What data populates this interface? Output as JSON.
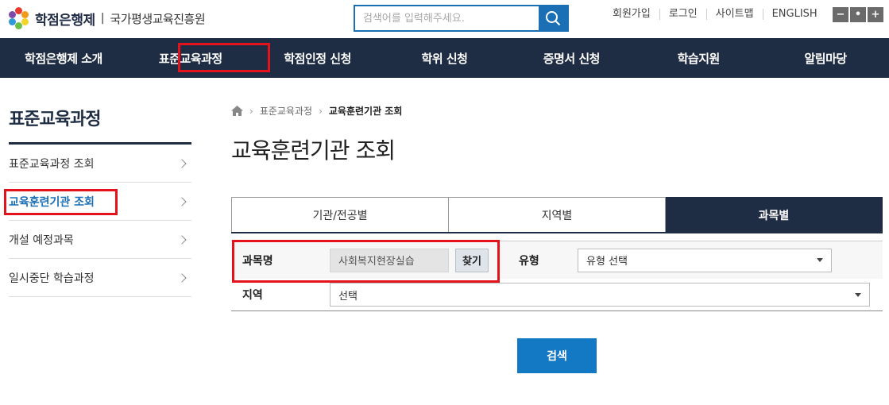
{
  "header": {
    "logo_title": "학점은행제",
    "logo_sub": "국가평생교육진흥원",
    "search_placeholder": "검색어를 입력해주세요.",
    "util_links": [
      "회원가입",
      "로그인",
      "사이트맵",
      "ENGLISH"
    ],
    "zoom": [
      "−",
      "•",
      "+"
    ],
    "logo_colors": [
      "#e8392f",
      "#f29a1b",
      "#f5d42a",
      "#6bbf47",
      "#2f9ad6",
      "#7d4aa8"
    ]
  },
  "gnb": {
    "items": [
      "학점은행제 소개",
      "표준교육과정",
      "학점인정 신청",
      "학위 신청",
      "증명서 신청",
      "학습지원",
      "알림마당"
    ],
    "active_index": 1
  },
  "sidebar": {
    "title": "표준교육과정",
    "items": [
      "표준교육과정 조회",
      "교육훈련기관 조회",
      "개설 예정과목",
      "일시중단 학습과정"
    ],
    "active_index": 1
  },
  "breadcrumb": {
    "parent": "표준교육과정",
    "current": "교육훈련기관 조회"
  },
  "page": {
    "title": "교육훈련기관 조회"
  },
  "tabs": {
    "items": [
      "기관/전공별",
      "지역별",
      "과목별"
    ],
    "active_index": 2
  },
  "form": {
    "subject_label": "과목명",
    "subject_value": "사회복지현장실습",
    "find_label": "찾기",
    "type_label": "유형",
    "type_value": "유형 선택",
    "region_label": "지역",
    "region_value": "선택"
  },
  "submit_label": "검색",
  "colors": {
    "navy": "#1f2d44",
    "accent": "#1a6fb5",
    "highlight": "#e4121a"
  }
}
